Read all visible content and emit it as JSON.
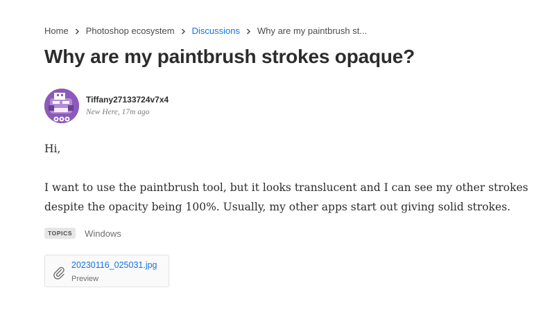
{
  "breadcrumb": {
    "items": [
      {
        "label": "Home"
      },
      {
        "label": "Photoshop ecosystem"
      },
      {
        "label": "Discussions"
      },
      {
        "label": "Why are my paintbrush st..."
      }
    ]
  },
  "post": {
    "title": "Why are my paintbrush strokes opaque?",
    "author": {
      "name": "Tiffany27133724v7x4",
      "meta": "New Here, 17m ago"
    },
    "greeting": "Hi,",
    "body": "I want to use the paintbrush tool, but it looks translucent and I can see my other strokes despite the opacity being 100%. Usually, my other apps start out giving solid strokes.",
    "topics_label": "TOPICS",
    "topic": "Windows",
    "attachment": {
      "file_name": "20230116_025031.jpg",
      "action": "Preview",
      "icon": "paperclip-icon"
    }
  },
  "colors": {
    "link": "#1473e6",
    "avatar_bg": "#8c5ab8",
    "text": "#2c2c2c"
  }
}
